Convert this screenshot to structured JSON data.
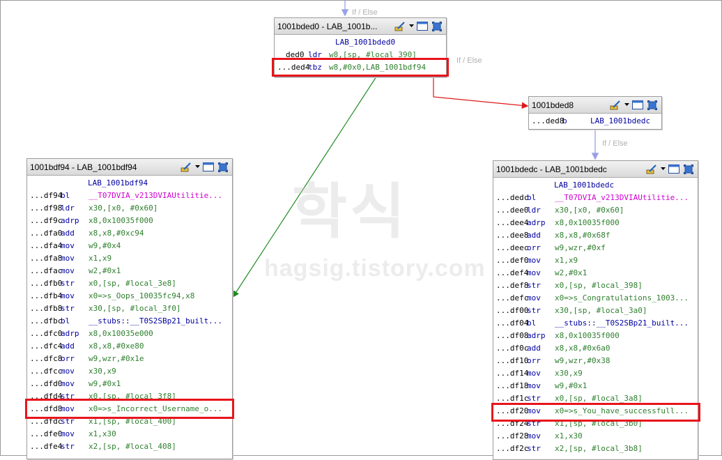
{
  "edge_labels": [
    "If / Else",
    "If / Else",
    "If / Else"
  ],
  "watermark": {
    "main": "학식",
    "sub": "hagsig.tistory.com"
  },
  "colors": {
    "true_edge": "#1e8a1e",
    "false_edge": "#e01818",
    "flow_edge": "#9aa0e6",
    "highlight": "#e8141c"
  },
  "blocks": {
    "top": {
      "title": "1001bded0 - LAB_1001b...",
      "label": "LAB_1001bded0",
      "rows": [
        {
          "addr": "ded0",
          "mn": "ldr",
          "ops": "w8,[sp, #local_390]"
        },
        {
          "addr": "...ded4",
          "mn": "tbz",
          "ops": "w8,#0x0,LAB_1001bdf94"
        }
      ]
    },
    "mid": {
      "title": "1001bded8",
      "rows": [
        {
          "addr": "...ded8",
          "mn": "b",
          "ops": "LAB_1001bdedc"
        }
      ]
    },
    "left": {
      "title": "1001bdf94 - LAB_1001bdf94",
      "label": "LAB_1001bdf94",
      "rows": [
        {
          "addr": "...df94",
          "mn": "bl",
          "ops": "__T07DVIA_v213DVIAUtilitie..."
        },
        {
          "addr": "...df98",
          "mn": "ldr",
          "ops": "x30,[x0, #0x60]"
        },
        {
          "addr": "...df9c",
          "mn": "adrp",
          "ops": "x8,0x10035f000"
        },
        {
          "addr": "...dfa0",
          "mn": "add",
          "ops": "x8,x8,#0xc94"
        },
        {
          "addr": "...dfa4",
          "mn": "mov",
          "ops": "w9,#0x4"
        },
        {
          "addr": "...dfa8",
          "mn": "mov",
          "ops": "x1,x9"
        },
        {
          "addr": "...dfac",
          "mn": "mov",
          "ops": "w2,#0x1"
        },
        {
          "addr": "...dfb0",
          "mn": "str",
          "ops": "x0,[sp, #local_3e8]"
        },
        {
          "addr": "...dfb4",
          "mn": "mov",
          "ops": "x0=>s_Oops_10035fc94,x8"
        },
        {
          "addr": "...dfb8",
          "mn": "str",
          "ops": "x30,[sp, #local_3f0]"
        },
        {
          "addr": "...dfbc",
          "mn": "bl",
          "ops": "__stubs::__T0S2SBp21_built..."
        },
        {
          "addr": "...dfc0",
          "mn": "adrp",
          "ops": "x8,0x10035e000"
        },
        {
          "addr": "...dfc4",
          "mn": "add",
          "ops": "x8,x8,#0xe80"
        },
        {
          "addr": "...dfc8",
          "mn": "orr",
          "ops": "w9,wzr,#0x1e"
        },
        {
          "addr": "...dfcc",
          "mn": "mov",
          "ops": "x30,x9"
        },
        {
          "addr": "...dfd0",
          "mn": "mov",
          "ops": "w9,#0x1"
        },
        {
          "addr": "...dfd4",
          "mn": "str",
          "ops": "x0,[sp, #local_3f8]"
        },
        {
          "addr": "...dfd8",
          "mn": "mov",
          "ops": "x0=>s_Incorrect_Username_o..."
        },
        {
          "addr": "...dfdc",
          "mn": "str",
          "ops": "x1,[sp, #local_400]"
        },
        {
          "addr": "...dfe0",
          "mn": "mov",
          "ops": "x1,x30"
        },
        {
          "addr": "...dfe4",
          "mn": "str",
          "ops": "x2,[sp, #local_408]"
        }
      ]
    },
    "right": {
      "title": "1001bdedc - LAB_1001bdedc",
      "label": "LAB_1001bdedc",
      "rows": [
        {
          "addr": "...dedc",
          "mn": "bl",
          "ops": "__T07DVIA_v213DVIAUtilitie..."
        },
        {
          "addr": "...dee0",
          "mn": "ldr",
          "ops": "x30,[x0, #0x60]"
        },
        {
          "addr": "...dee4",
          "mn": "adrp",
          "ops": "x8,0x10035f000"
        },
        {
          "addr": "...dee8",
          "mn": "add",
          "ops": "x8,x8,#0x68f"
        },
        {
          "addr": "...deec",
          "mn": "orr",
          "ops": "w9,wzr,#0xf"
        },
        {
          "addr": "...def0",
          "mn": "mov",
          "ops": "x1,x9"
        },
        {
          "addr": "...def4",
          "mn": "mov",
          "ops": "w2,#0x1"
        },
        {
          "addr": "...def8",
          "mn": "str",
          "ops": "x0,[sp, #local_398]"
        },
        {
          "addr": "...defc",
          "mn": "mov",
          "ops": "x0=>s_Congratulations_1003..."
        },
        {
          "addr": "...df00",
          "mn": "str",
          "ops": "x30,[sp, #local_3a0]"
        },
        {
          "addr": "...df04",
          "mn": "bl",
          "ops": "__stubs::__T0S2SBp21_built..."
        },
        {
          "addr": "...df08",
          "mn": "adrp",
          "ops": "x8,0x10035f000"
        },
        {
          "addr": "...df0c",
          "mn": "add",
          "ops": "x8,x8,#0x6a0"
        },
        {
          "addr": "...df10",
          "mn": "orr",
          "ops": "w9,wzr,#0x38"
        },
        {
          "addr": "...df14",
          "mn": "mov",
          "ops": "x30,x9"
        },
        {
          "addr": "...df18",
          "mn": "mov",
          "ops": "w9,#0x1"
        },
        {
          "addr": "...df1c",
          "mn": "str",
          "ops": "x0,[sp, #local_3a8]"
        },
        {
          "addr": "...df20",
          "mn": "mov",
          "ops": "x0=>s_You_have_successfull..."
        },
        {
          "addr": "...df24",
          "mn": "str",
          "ops": "x1,[sp, #local_3b0]"
        },
        {
          "addr": "...df28",
          "mn": "mov",
          "ops": "x1,x30"
        },
        {
          "addr": "...df2c",
          "mn": "str",
          "ops": "x2,[sp, #local_3b8]"
        }
      ]
    }
  }
}
